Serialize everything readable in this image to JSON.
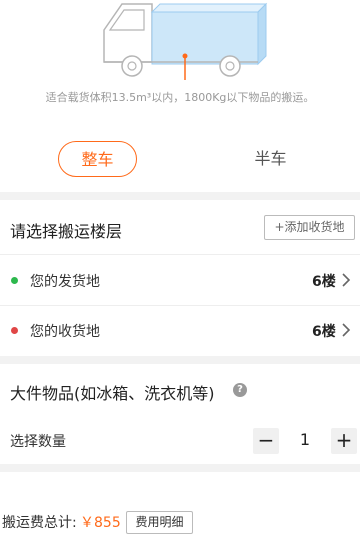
{
  "vehicle": {
    "capacity_note": "适合载货体积13.5m³以内，1800Kg以下物品的搬运。"
  },
  "tabs": [
    {
      "label": "整车",
      "active": true
    },
    {
      "label": "半车",
      "active": false
    }
  ],
  "floor_section": {
    "title": "请选择搬运楼层",
    "add_address_label": "+添加收货地",
    "origin": {
      "label": "您的发货地",
      "floor": "6楼",
      "dot_color": "#2db84d"
    },
    "destination": {
      "label": "您的收货地",
      "floor": "6楼",
      "dot_color": "#e04646"
    }
  },
  "items_section": {
    "title": "大件物品(如冰箱、洗衣机等)",
    "help_icon": "?",
    "quantity_label": "选择数量",
    "minus_label": "−",
    "plus_label": "+",
    "quantity": "1"
  },
  "footer": {
    "total_label": "搬运费总计:",
    "total_value": "￥855",
    "detail_button_label": "费用明细"
  },
  "colors": {
    "accent": "#ff6a1a",
    "truck_cargo": "#cde7f9",
    "background_gap": "#f2f2f2"
  }
}
